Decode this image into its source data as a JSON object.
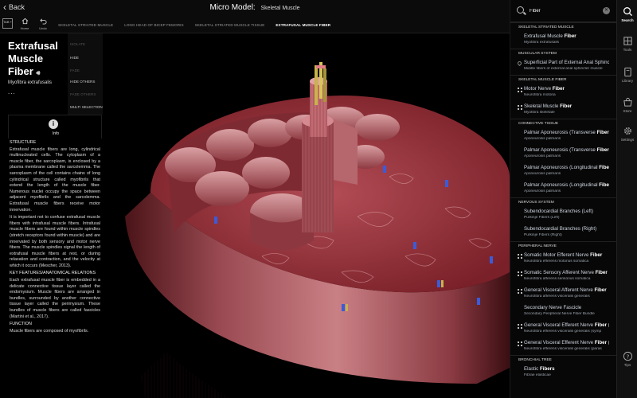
{
  "header": {
    "back_label": "Back",
    "title": "Micro Model:",
    "subtitle": "Skeletal Muscle"
  },
  "toolbar": {
    "tab_label": "TAB +",
    "home_label": "Home",
    "undo_label": "Undo",
    "breadcrumbs": [
      "SKELETAL STRIATED MUSCLE",
      "LONG HEAD OF BICEP FEMORIS",
      "SKELETAL STRIATED MUSCLE TISSUE",
      "EXTRAFUSAL MUSCLE FIBER"
    ]
  },
  "structure": {
    "title": "Extrafusal Muscle Fiber",
    "title_line1": "Extrafusal",
    "title_line2": "Muscle",
    "title_line3": "Fiber",
    "latin_name": "Myofibra extrafusalis",
    "more": "..."
  },
  "context_menu": {
    "items": [
      {
        "label": "ISOLATE",
        "enabled": false
      },
      {
        "label": "HIDE",
        "enabled": true
      },
      {
        "label": "FADE",
        "enabled": false
      },
      {
        "label": "HIDE OTHERS",
        "enabled": true
      },
      {
        "label": "FADE OTHERS",
        "enabled": false
      },
      {
        "label": "MULTI SELECTION",
        "enabled": true
      }
    ]
  },
  "info_tab": {
    "icon": "i",
    "label": "Info"
  },
  "description": {
    "structure_heading": "STRUCTURE",
    "p1": "Extrafusal muscle fibers are long, cylindrical multinucleated cells. The cytoplasm of a muscle fiber, the sarcoplasm, is enclosed by a plasma membrane called the sarcolemma. The sarcoplasm of the cell contains chains of long cylindrical structure called myofibrils that extend the length of the muscle fiber. Numerous nuclei occupy the space between adjacent myofibrils and the sarcolemma. Extrafusal muscle fibers receive motor innervation.",
    "p2": "It is important not to confuse extrafusal muscle fibers with intrafusal muscle fibers. Intrafusal muscle fibers are found within muscle spindles (stretch receptors found within muscle) and are innervated by both sensory and motor nerve fibers. The muscle spindles signal the length of extrafusal muscle fibers at rest, or during relaxation and contraction, and the velocity at which it occurs (Mescher, 2013).",
    "features_heading": "KEY FEATURES/ANATOMICAL RELATIONS",
    "p3": "Each extrafusal muscle fiber is embedded in a delicate connective tissue layer called the endomysium. Muscle fibers are arranged in bundles, surrounded by another connective tissue layer called the perimysium. These bundles of muscle fibers are called fascicles (Martini et al., 2017).",
    "function_heading": "FUNCTION",
    "p4": "Muscle fibers are composed of myofibrils."
  },
  "search": {
    "query": "Fiber",
    "placeholder": "Search",
    "clear_icon": "clear-icon",
    "results": [
      {
        "type": "category",
        "label": "SKELETAL STRIATED MUSCLE"
      },
      {
        "type": "item",
        "pre": "Extrafusal Muscle ",
        "hl": "Fiber",
        "post": "",
        "sub": "Myofibra extrafusalis",
        "icon": "none"
      },
      {
        "type": "category",
        "label": "MUSCULAR SYSTEM"
      },
      {
        "type": "item",
        "pre": "Superficial Part of External Anal Sphincter",
        "hl": "",
        "post": "",
        "sub": "Middle fibers of external anal sphincter muscle",
        "icon": "pin"
      },
      {
        "type": "category",
        "label": "SKELETAL MUSCLE FIBER"
      },
      {
        "type": "item",
        "pre": "Motor Nerve ",
        "hl": "Fiber",
        "post": "",
        "sub": "Neurofibra motoria",
        "icon": "grid"
      },
      {
        "type": "item",
        "pre": "Skeletal Muscle ",
        "hl": "Fiber",
        "post": "",
        "sub": "Myofibra skeletale",
        "icon": "grid"
      },
      {
        "type": "category",
        "label": "CONNECTIVE TISSUE"
      },
      {
        "type": "item",
        "pre": "Palmar Aponeurosis (Transverse ",
        "hl": "Fibers",
        "post": "; Le",
        "sub": "Aponeurosis palmaris",
        "icon": "none"
      },
      {
        "type": "item",
        "pre": "Palmar Aponeurosis (Transverse ",
        "hl": "Fibers",
        "post": "; Ri",
        "sub": "Aponeurosis palmaris",
        "icon": "none"
      },
      {
        "type": "item",
        "pre": "Palmar Aponeurosis (Longitudinal ",
        "hl": "Fibers",
        "post": ";",
        "sub": "Aponeurosis palmaris",
        "icon": "none"
      },
      {
        "type": "item",
        "pre": "Palmar Aponeurosis (Longitudinal ",
        "hl": "Fibers",
        "post": ";",
        "sub": "Aponeurosis palmaris",
        "icon": "none"
      },
      {
        "type": "category",
        "label": "NERVOUS SYSTEM"
      },
      {
        "type": "item",
        "pre": "Subendocardial Branches (Left)",
        "hl": "",
        "post": "",
        "sub": "Purkinje Fibers (Left)",
        "icon": "none"
      },
      {
        "type": "item",
        "pre": "Subendocardial Branches (Right)",
        "hl": "",
        "post": "",
        "sub": "Purkinje Fibers (Right)",
        "icon": "none"
      },
      {
        "type": "category",
        "label": "PERIPHERAL NERVE"
      },
      {
        "type": "item",
        "pre": "Somatic Motor Efferent Nerve ",
        "hl": "Fiber",
        "post": "",
        "sub": "Neurofibra efferens motorius somatica",
        "icon": "grid"
      },
      {
        "type": "item",
        "pre": "Somatic Sensory Afferent Nerve ",
        "hl": "Fiber",
        "post": "",
        "sub": "Neurofibra afferens sensorius somatica",
        "icon": "grid"
      },
      {
        "type": "item",
        "pre": "General Visceral Afferent Nerve ",
        "hl": "Fiber",
        "post": "",
        "sub": "Neurofibra afferens visceralis generalis",
        "icon": "grid"
      },
      {
        "type": "item",
        "pre": "Secondary Nerve Fascicle",
        "hl": "",
        "post": "",
        "sub": "Secondary Peripheral Nerve Fiber Bundle",
        "icon": "none"
      },
      {
        "type": "item",
        "pre": "General Visceral Efferent Nerve ",
        "hl": "Fiber",
        "post": " (S",
        "sub": "Neurofibra efferens visceralis generalis (symp",
        "icon": "grid"
      },
      {
        "type": "item",
        "pre": "General Visceral Efferent Nerve ",
        "hl": "Fiber",
        "post": " (P",
        "sub": "Neurofibra efferens visceralis generalis (paras",
        "icon": "grid"
      },
      {
        "type": "category",
        "label": "BRONCHIAL TREE"
      },
      {
        "type": "item",
        "pre": "Elastic ",
        "hl": "Fibers",
        "post": "",
        "sub": "Fibrae elasticae",
        "icon": "none"
      }
    ]
  },
  "nav": {
    "items": [
      {
        "label": "Search",
        "icon": "search-icon",
        "active": true
      },
      {
        "label": "Tools",
        "icon": "tools-icon",
        "active": false
      },
      {
        "label": "Library",
        "icon": "library-icon",
        "active": false
      },
      {
        "label": "Store",
        "icon": "store-icon",
        "active": false
      },
      {
        "label": "Settings",
        "icon": "gear-icon",
        "active": false
      },
      {
        "label": "Tips",
        "icon": "help-icon",
        "active": false
      }
    ]
  },
  "colors": {
    "muscle_dark": "#6e2026",
    "muscle_mid": "#a3404a",
    "muscle_light": "#d98b8f",
    "nerve_yellow": "#c9b34a",
    "vessel_blue": "#3b5bd9",
    "panel_bg": "#070707",
    "accent": "#ffffff"
  }
}
